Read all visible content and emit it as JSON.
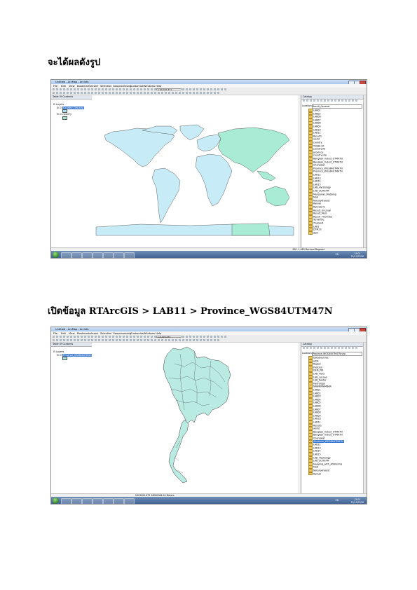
{
  "headings": {
    "first": "จะได้ผลดังรูป",
    "second": "เปิดข้อมูล RTArcGIS > LAB11 > Province_WGS84UTM47N"
  },
  "shot1": {
    "window_title": "Untitled - ArcMap - ArcInfo",
    "menu": [
      "File",
      "Edit",
      "View",
      "Bookmarks",
      "Insert",
      "Selection",
      "Geoprocessing",
      "Customize",
      "Windows",
      "Help"
    ],
    "scale": "1:90,432,371",
    "toc_title": "Table Of Contents",
    "toc": [
      "Layers",
      "Country_Geo.shp",
      "country"
    ],
    "catalog_title": "Catalog",
    "location_label": "Location:",
    "location_value": "Result_Generat",
    "catalog_items": [
      "LAB01",
      "LAB02",
      "LAB06",
      "LAB07",
      "LAB08",
      "LAB09",
      "LAB10",
      "LAB11",
      "Results",
      "world",
      "country",
      "Y2000.lkt",
      "country.lkt",
      "province",
      "country.shp",
      "Bangkok_Indust_UTM47N",
      "Bangkok_Indust_UTM47N",
      "Changwat",
      "Province_WGS84UTM47N",
      "Province_WGS84UTM47N",
      "LAB12",
      "LAB13",
      "LAB14",
      "LAB15",
      "LAB_Hydrology",
      "LAB_SUITEYM",
      "Manpower_Mabbing",
      "Mod",
      "NatureAnalyst",
      "Rainall",
      "Rainstorm",
      "Result_Unusual",
      "Result_Mod",
      "Result_Thematic",
      "Terrailure",
      "Thailand",
      "LAB1",
      "DTM23",
      "dem"
    ],
    "status": "950 -1.083 Decimal Degrees",
    "clock_time": "13:01",
    "clock_date": "25/10/2556",
    "taskbar_lang": "EN"
  },
  "shot2": {
    "window_title": "Untitled - ArcMap - ArcInfo",
    "menu": [
      "File",
      "Edit",
      "View",
      "Bookmarks",
      "Insert",
      "Selection",
      "Geoprocessing",
      "Customize",
      "Windows",
      "Help"
    ],
    "scale": "1:9,923,273",
    "toc_title": "Table Of Contents",
    "toc": [
      "Layers",
      "Province_WGS84UTM47N"
    ],
    "catalog_title": "Catalog",
    "location_label": "Location:",
    "location_value": "Province_WGS84UTM47N.shp",
    "catalog_items": [
      "DataExercise",
      "orbit",
      "Region",
      "Position",
      "DEM_PM",
      "LAB_Field",
      "LAB_LaLoan",
      "LAB_Raster",
      "Hydrology",
      "NAWRIMAMBAR",
      "LAB01",
      "LAB02",
      "LAB03",
      "LAB04",
      "LAB05",
      "LAB06",
      "LAB07",
      "LAB08",
      "LAB09",
      "LAB10",
      "LAB11",
      "Results",
      "world",
      "Bangkok_Indust_UTM47N",
      "Bangkok_Indust_UTM47N",
      "Changwat",
      "Province_WGS84UTM47N",
      "LAB12",
      "LAB13",
      "LAB14",
      "LAB15",
      "LAB_Hydrology",
      "LAB_SUITEYM",
      "Mapping_with_Addresing",
      "Mod",
      "NatureAnalyst",
      "Rainall"
    ],
    "status": "2001991.675 16000064.94 Meters",
    "clock_time": "13:01",
    "clock_date": "25/10/2556",
    "taskbar_lang": "EN"
  }
}
